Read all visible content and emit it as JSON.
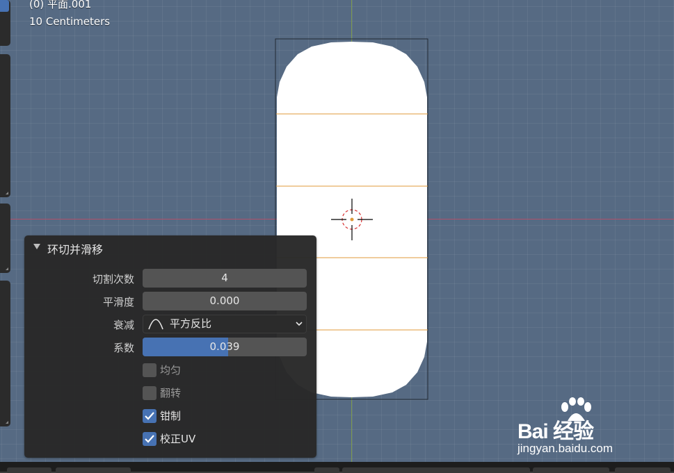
{
  "viewport": {
    "object_label": "(0) 平面.001",
    "grid_scale": "10 Centimeters"
  },
  "operator_panel": {
    "title": "环切并滑移",
    "properties": {
      "cuts_label": "切割次数",
      "cuts_value": "4",
      "smoothness_label": "平滑度",
      "smoothness_value": "0.000",
      "falloff_label": "衰减",
      "falloff_value": "平方反比",
      "falloff_icon": "inverse-square-curve-icon",
      "factor_label": "系数",
      "factor_value": "0.039",
      "factor_fraction": 0.52
    },
    "checkboxes": [
      {
        "label": "均匀",
        "checked": false
      },
      {
        "label": "翻转",
        "checked": false
      },
      {
        "label": "钳制",
        "checked": true
      },
      {
        "label": "校正UV",
        "checked": true
      }
    ]
  },
  "watermark": {
    "brand": "Bai  经验",
    "url": "jingyan.baidu.com",
    "icon": "baidu-paw-icon"
  },
  "colors": {
    "viewport_bg": "#566a83",
    "accent_blue": "#4772b3",
    "edge_orange": "#e09a3a",
    "axis_red": "#b0506a",
    "axis_green": "#7c9a4f"
  }
}
